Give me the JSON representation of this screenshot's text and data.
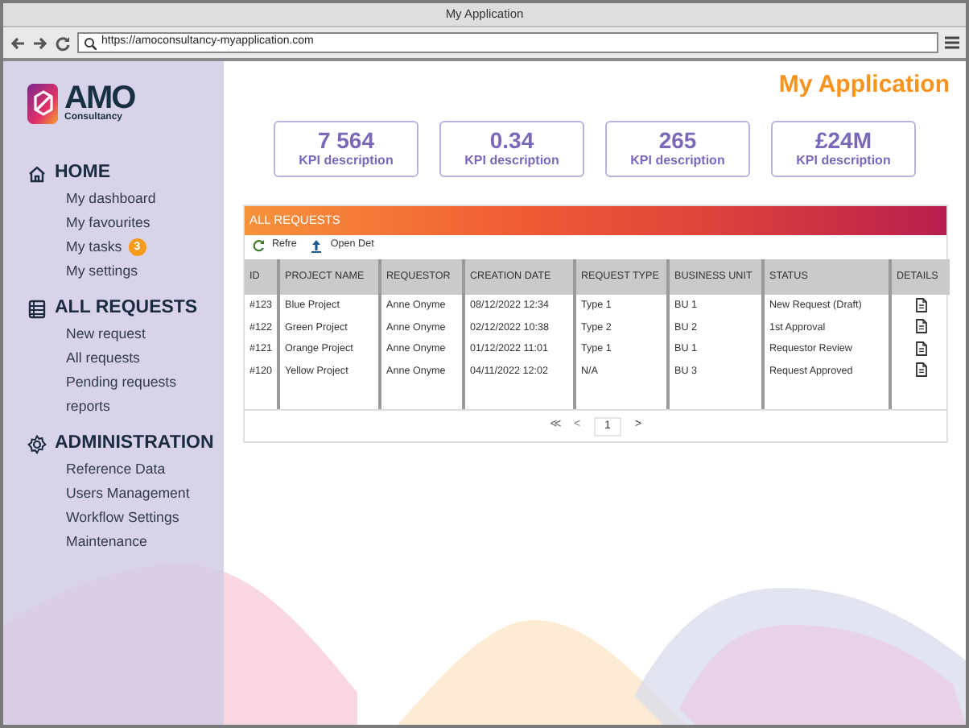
{
  "window": {
    "title": "My Application"
  },
  "browser": {
    "url": "https://amoconsultancy-myapplication.com"
  },
  "logo": {
    "name": "AMO",
    "tagline": "Consultancy"
  },
  "page_title": "My Application",
  "sidebar": {
    "sections": [
      {
        "title": "HOME",
        "items": [
          {
            "label": "My dashboard"
          },
          {
            "label": "My favourites"
          },
          {
            "label": "My tasks",
            "badge": "3"
          },
          {
            "label": "My settings"
          }
        ]
      },
      {
        "title": "ALL REQUESTS",
        "items": [
          {
            "label": "New request"
          },
          {
            "label": "All requests"
          },
          {
            "label": "Pending requests"
          },
          {
            "label": "reports"
          }
        ]
      },
      {
        "title": "ADMINISTRATION",
        "items": [
          {
            "label": "Reference Data"
          },
          {
            "label": "Users Management"
          },
          {
            "label": "Workflow Settings"
          },
          {
            "label": "Maintenance"
          }
        ]
      }
    ]
  },
  "kpis": [
    {
      "value": "7 564",
      "label": "KPI description"
    },
    {
      "value": "0.34",
      "label": "KPI description"
    },
    {
      "value": "265",
      "label": "KPI description"
    },
    {
      "value": "£24M",
      "label": "KPI description"
    }
  ],
  "requests": {
    "title": "ALL REQUESTS",
    "toolbar": [
      "Refre",
      "Open Det"
    ],
    "columns": [
      "ID",
      "PROJECT NAME",
      "REQUESTOR",
      "CREATION DATE",
      "REQUEST TYPE",
      "BUSINESS UNIT",
      "STATUS",
      "DETAILS"
    ],
    "rows": [
      {
        "id": "#123",
        "project": "Blue Project",
        "requestor": "Anne Onyme",
        "date": "08/12/2022 12:34",
        "type": "Type 1",
        "unit": "BU 1",
        "status": "New Request (Draft)"
      },
      {
        "id": "#122",
        "project": "Green Project",
        "requestor": "Anne Onyme",
        "date": "02/12/2022 10:38",
        "type": "Type 2",
        "unit": "BU 2",
        "status": "1st Approval"
      },
      {
        "id": "#121",
        "project": "Orange Project",
        "requestor": "Anne Onyme",
        "date": "01/12/2022 11:01",
        "type": "Type 1",
        "unit": "BU 1",
        "status": "Requestor Review"
      },
      {
        "id": "#120",
        "project": "Yellow Project",
        "requestor": "Anne Onyme",
        "date": "04/11/2022 12:02",
        "type": "N/A",
        "unit": "BU 3",
        "status": "Request Approved"
      }
    ],
    "pagination": {
      "first": "≪",
      "prev": "<",
      "page": "1",
      "next": ">"
    }
  }
}
